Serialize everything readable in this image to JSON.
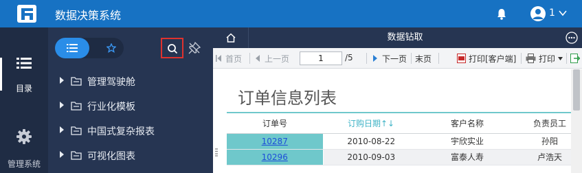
{
  "app": {
    "title": "数据决策系统"
  },
  "header": {
    "user_name": "1"
  },
  "leftnav": {
    "items": [
      {
        "label": "目录",
        "icon": "list-icon",
        "active": true
      },
      {
        "label": "管理系统",
        "icon": "gear-icon",
        "active": false
      }
    ]
  },
  "dirpanel": {
    "tree": [
      {
        "label": "管理驾驶舱"
      },
      {
        "label": "行业化模板"
      },
      {
        "label": "中国式复杂报表"
      },
      {
        "label": "可视化图表"
      }
    ]
  },
  "tabs": {
    "report_tab": "数据钻取"
  },
  "toolbar": {
    "first": "首页",
    "prev": "上一页",
    "page_value": "1",
    "page_total": "/5",
    "next": "下一页",
    "last": "末页",
    "print_client": "打印[客户端]",
    "print": "打印"
  },
  "report": {
    "title": "订单信息列表",
    "columns": [
      "订单号",
      "订购日期↑↓",
      "客户名称",
      "负责员工"
    ],
    "rows": [
      {
        "id": "10287",
        "date": "2010-08-22",
        "customer": "宇欣实业",
        "employee": "孙阳"
      },
      {
        "id": "10296",
        "date": "2010-09-03",
        "customer": "富泰人寿",
        "employee": "卢浩天"
      }
    ]
  },
  "colors": {
    "header_bg": "#1772c3",
    "nav_bg": "#1f2c44",
    "panel_bg": "#263552",
    "accent": "#2a8de8",
    "highlight_border": "#e0322e",
    "teal": "#6fc8cb"
  }
}
